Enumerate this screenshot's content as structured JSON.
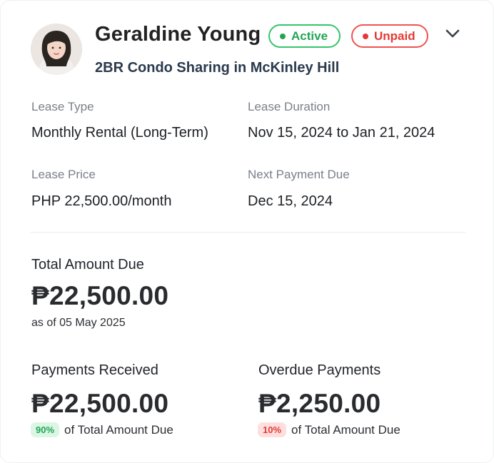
{
  "tenant": {
    "name": "Geraldine Young",
    "property": "2BR Condo Sharing in McKinley Hill",
    "status_badges": [
      {
        "label": "Active",
        "color": "#22a654"
      },
      {
        "label": "Unpaid",
        "color": "#e53935"
      }
    ],
    "expand_icon": "chevron-down-icon"
  },
  "lease": {
    "type_label": "Lease Type",
    "type_value": "Monthly Rental (Long-Term)",
    "duration_label": "Lease Duration",
    "duration_value": "Nov 15, 2024 to Jan 21, 2024",
    "price_label": "Lease Price",
    "price_value": "PHP 22,500.00/month",
    "next_due_label": "Next Payment Due",
    "next_due_value": "Dec 15, 2024"
  },
  "summary": {
    "total_label": "Total Amount Due",
    "total_value": "₱22,500.00",
    "as_of": "as of 05 May 2025",
    "received_label": "Payments Received",
    "received_value": "₱22,500.00",
    "received_pct": "90%",
    "received_pct_caption": "of Total Amount Due",
    "overdue_label": "Overdue Payments",
    "overdue_value": "₱2,250.00",
    "overdue_pct": "10%",
    "overdue_pct_caption": "of Total Amount Due"
  }
}
